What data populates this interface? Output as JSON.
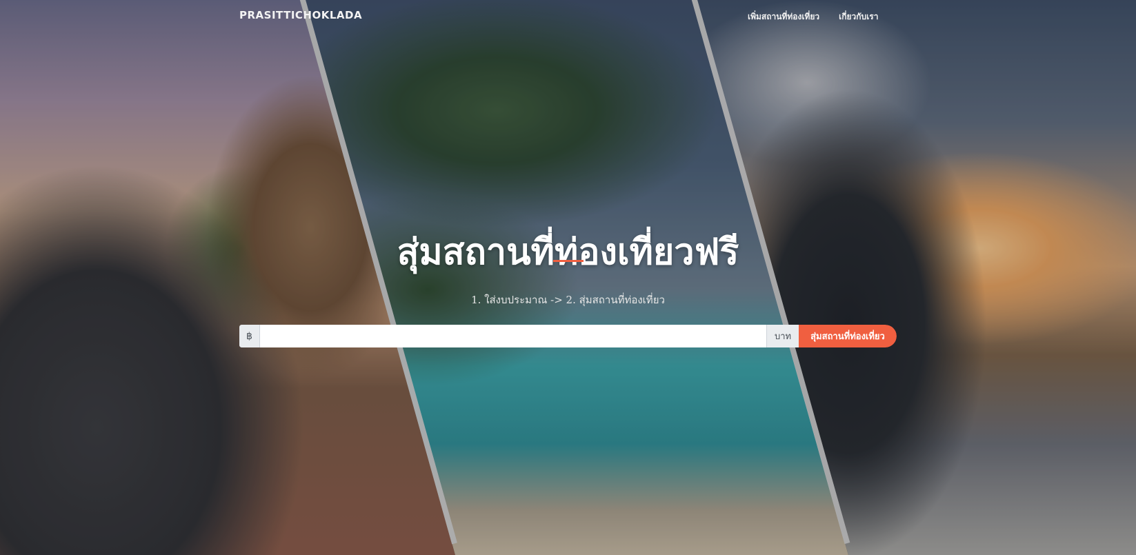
{
  "navbar": {
    "brand": "PRASITTICHOKLADA",
    "links": [
      "เพิ่มสถานที่ท่องเที่ยว",
      "เกี่ยวกับเรา"
    ]
  },
  "hero": {
    "title": "สุ่มสถานที่ท่องเที่ยวฟรี",
    "subtitle": "1. ใส่งบประมาณ -> 2. สุ่มสถานที่ท่องเที่ยว",
    "accent_color": "#f05f40",
    "panels": [
      "elephant-temple-photo",
      "palm-beach-photo",
      "sunset-cliff-photo"
    ]
  },
  "search": {
    "prefix": "฿",
    "value": "",
    "placeholder": "",
    "suffix": "บาท",
    "button_label": "สุ่มสถานที่ท่องเที่ยว",
    "button_color": "#f05f40"
  }
}
